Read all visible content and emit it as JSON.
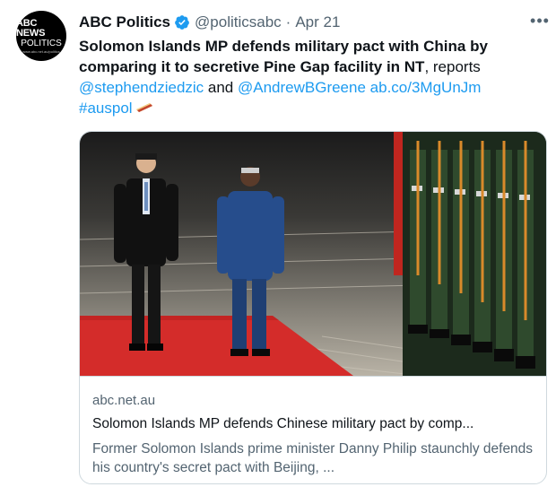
{
  "author": {
    "avatar_lines": [
      "ABC NEWS",
      "POLITICS",
      "www.abc.net.au/politics"
    ],
    "name": "ABC Politics",
    "handle": "@politicsabc",
    "separator": "·",
    "time": "Apr 21"
  },
  "more_label": "•••",
  "tweet": {
    "bold_text": "Solomon Islands MP defends military pact with China by comparing it to secretive Pine Gap facility in NT",
    "after_bold": ", reports",
    "mention1": "@stephendziedzic",
    "and_word": " and ",
    "mention2": "@AndrewBGreene",
    "link": "ab.co/3MgUnJm",
    "hashtag": "#auspol"
  },
  "card": {
    "domain": "abc.net.au",
    "title": "Solomon Islands MP defends Chinese military pact by comp...",
    "description": "Former Solomon Islands prime minister Danny Philip staunchly defends his country's secret pact with Beijing, ..."
  },
  "colors": {
    "link": "#1d9bf0",
    "secondary_text": "#536471",
    "verified": "#1d9bf0",
    "red_carpet": "#d42c2a"
  },
  "icons": [
    "verified-badge-icon",
    "more-icon",
    "auspol-hashflag-icon"
  ]
}
